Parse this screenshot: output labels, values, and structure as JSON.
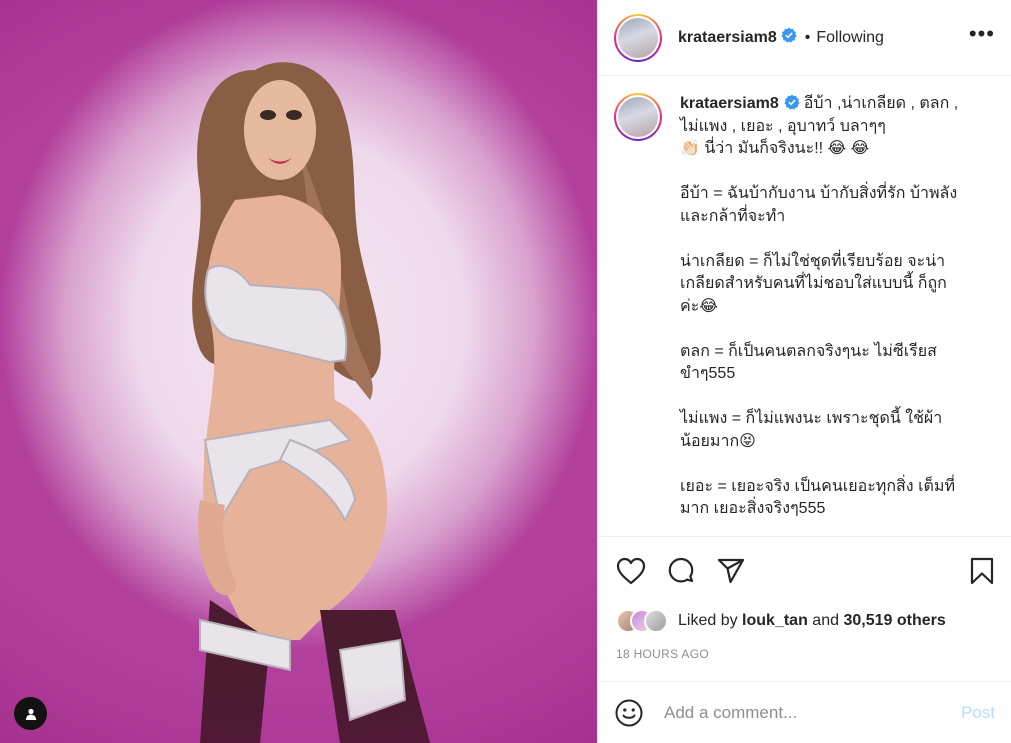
{
  "post": {
    "username": "krataersiam8",
    "follow_status": "Following",
    "dot": "•",
    "more_label": "•••",
    "caption_lines": [
      "อีบ้า ,น่าเกลียด , ตลก ,",
      "ไม่แพง , เยอะ , อุบาทว์ บลาๆๆ",
      "👏🏻 นี่ว่า มันก็จริงนะ!! 😂 😂",
      "",
      "อีบ้า = ฉันบ้ากับงาน บ้ากับสิ่งที่รัก บ้าพลัง",
      "และกล้าที่จะทำ",
      "",
      "น่าเกลียด = ก็ไม่ใช่ชุดที่เรียบร้อย จะน่า",
      "เกลียดสำหรับคนที่ไม่ชอบใส่แบบนี้ ก็ถูก",
      "ค่ะ😂",
      "",
      "ตลก = ก็เป็นคนตลกจริงๆนะ ไม่ซีเรียส",
      "ขำๆ555",
      "",
      "ไม่แพง = ก็ไม่แพงนะ เพราะชุดนี้ ใช้ผ้า",
      "น้อยมาก😝",
      "",
      "เยอะ = เยอะจริง เป็นคนเยอะทุกสิ่ง เต็มที่",
      "มาก เยอะสิ่งจริงๆ555"
    ]
  },
  "likes": {
    "prefix": "Liked by",
    "liked_user": "louk_tan",
    "and": "and",
    "others": "30,519 others"
  },
  "time_ago": "18 HOURS AGO",
  "comment": {
    "placeholder": "Add a comment...",
    "post_label": "Post"
  },
  "colors": {
    "link_blue": "#0095f6",
    "post_disabled": "#b2dffc",
    "verified": "#3897f0",
    "muted": "#8e8e8e",
    "photo_magenta": "#b23f9c"
  },
  "icons": {
    "like": "heart-icon",
    "comment": "comment-bubble-icon",
    "share": "paper-plane-icon",
    "save": "bookmark-icon",
    "emoji": "smiley-icon",
    "tag": "user-tag-icon",
    "verified": "verified-badge-icon"
  }
}
